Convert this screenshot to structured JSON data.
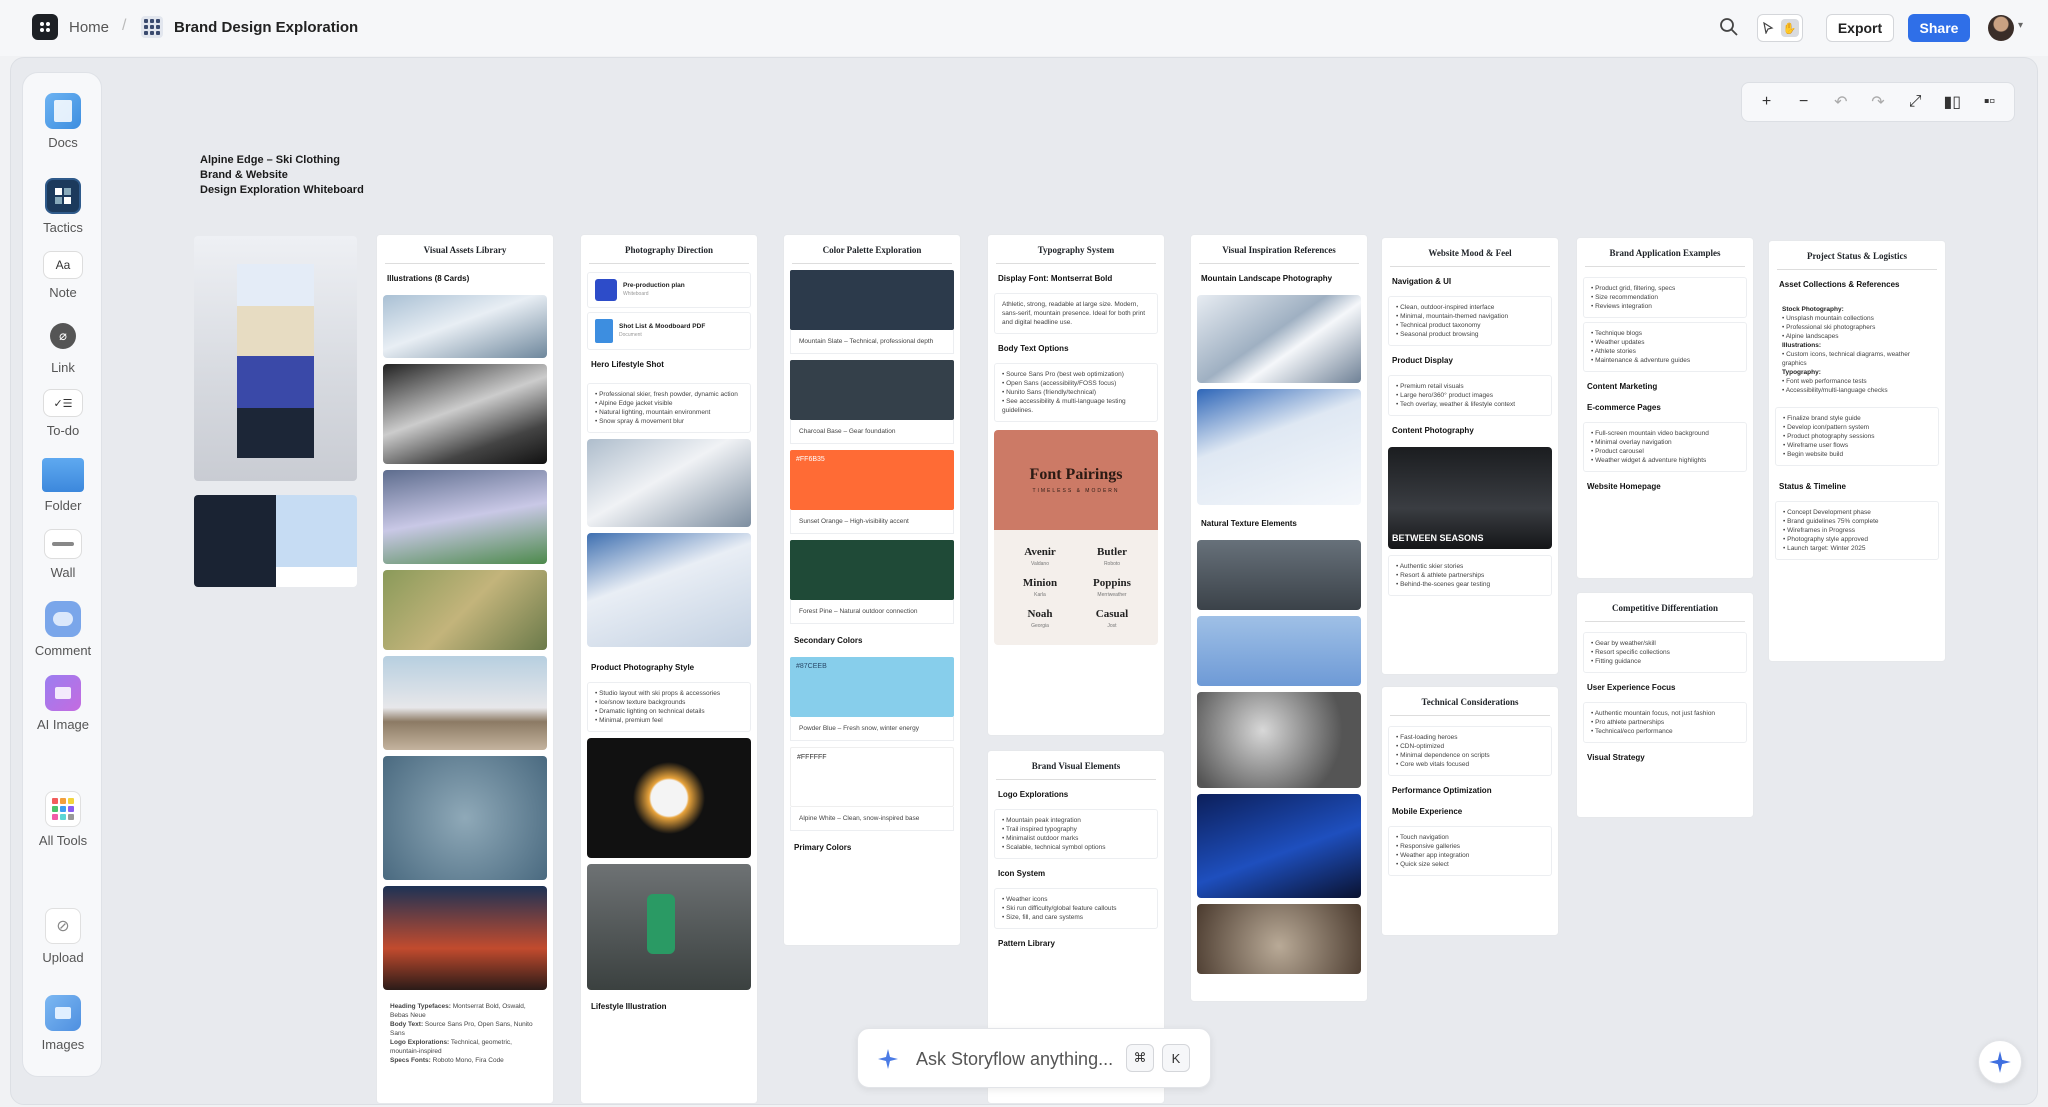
{
  "topbar": {
    "home": "Home",
    "title": "Brand Design Exploration",
    "export": "Export",
    "share": "Share"
  },
  "sidebar": {
    "items": [
      {
        "label": "Docs"
      },
      {
        "label": "Tactics"
      },
      {
        "label": "Note",
        "glyph": "Aa"
      },
      {
        "label": "Link"
      },
      {
        "label": "To-do"
      },
      {
        "label": "Folder"
      },
      {
        "label": "Wall"
      },
      {
        "label": "Comment"
      },
      {
        "label": "AI Image"
      },
      {
        "label": "All Tools"
      },
      {
        "label": "Upload"
      },
      {
        "label": "Images"
      }
    ]
  },
  "board": {
    "title_lines": [
      "Alpine Edge – Ski Clothing",
      "Brand & Website",
      "Design Exploration Whiteboard"
    ]
  },
  "visual_assets": {
    "header": "Visual Assets Library",
    "sub": "Illustrations (8 Cards)",
    "footer": [
      [
        "Heading Typefaces:",
        " Montserrat Bold, Oswald, Bebas Neue"
      ],
      [
        "Body Text:",
        " Source Sans Pro, Open Sans, Nunito Sans"
      ],
      [
        "Logo Explorations:",
        " Technical, geometric, mountain-inspired"
      ],
      [
        "Specs Fonts:",
        " Roboto Mono, Fira Code"
      ]
    ]
  },
  "photography": {
    "header": "Photography Direction",
    "doc1_title": "Pre-production plan",
    "doc1_sub": "Whiteboard",
    "doc2_title": "Shot List & Moodboard PDF",
    "doc2_sub": "Document",
    "hero": "Hero Lifestyle Shot",
    "hero_bullets": [
      "• Professional skier, fresh powder, dynamic action",
      "• Alpine Edge jacket visible",
      "• Natural lighting, mountain environment",
      "• Snow spray & movement blur"
    ],
    "product": "Product Photography Style",
    "product_bullets": [
      "• Studio layout with ski props & accessories",
      "• Ice/snow texture backgrounds",
      "• Dramatic lighting on technical details",
      "• Minimal, premium feel"
    ],
    "lifestyle": "Lifestyle Illustration"
  },
  "palette": {
    "header": "Color Palette Exploration",
    "swatches": [
      {
        "hex": "",
        "color": "#2c3a4b",
        "label": "Mountain Slate – Technical, professional depth"
      },
      {
        "hex": "",
        "color": "#34404a",
        "label": "Charcoal Base – Gear foundation"
      },
      {
        "hex": "#FF6B35",
        "color": "#ff6b35",
        "label": "Sunset Orange – High-visibility accent"
      },
      {
        "hex": "",
        "color": "#1f4a37",
        "label": "Forest Pine – Natural outdoor connection"
      }
    ],
    "secondary": "Secondary Colors",
    "secondary_swatches": [
      {
        "hex": "#87CEEB",
        "color": "#87ceeb",
        "label": "Powder Blue – Fresh snow, winter energy"
      },
      {
        "hex": "#FFFFFF",
        "color": "#ffffff",
        "label": "Alpine White – Clean, snow-inspired base"
      }
    ],
    "primary": "Primary Colors"
  },
  "typography": {
    "header": "Typography System",
    "display": "Display Font: Montserrat Bold",
    "display_text": "Athletic, strong, readable at large size. Modern, sans-serif, mountain presence. Ideal for both print and digital headline use.",
    "body": "Body Text Options",
    "body_bullets": [
      "• Source Sans Pro (best web optimization)",
      "• Open Sans (accessibility/FOSS focus)",
      "• Nunito Sans (friendly/technical)",
      "• See accessibility & multi-language testing guidelines."
    ],
    "fp_title": "Font Pairings",
    "fp_sub": "TIMELESS & MODERN",
    "fp_pairs": [
      {
        "a": "Avenir",
        "as": "Valdano",
        "b": "Butler",
        "bs": "Roboto"
      },
      {
        "a": "Minion",
        "as": "Karla",
        "b": "Poppins",
        "bs": "Merriweather"
      },
      {
        "a": "Noah",
        "as": "Georgia",
        "b": "Casual",
        "bs": "Jost"
      }
    ]
  },
  "brand_visual": {
    "header": "Brand Visual Elements",
    "logo": "Logo Explorations",
    "logo_bullets": [
      "• Mountain peak integration",
      "• Trail inspired typography",
      "• Minimalist outdoor marks",
      "• Scalable, technical symbol options"
    ],
    "icon": "Icon System",
    "icon_bullets": [
      "• Weather icons",
      "• Ski run difficulty/global feature callouts",
      "• Size, fill, and care systems"
    ],
    "pattern": "Pattern Library"
  },
  "inspiration": {
    "header": "Visual Inspiration References",
    "mountain": "Mountain Landscape Photography",
    "natural": "Natural Texture Elements"
  },
  "website": {
    "header": "Website Mood & Feel",
    "nav": "Navigation & UI",
    "nav_bullets": [
      "• Clean, outdoor-inspired interface",
      "• Minimal, mountain-themed navigation",
      "• Technical product taxonomy",
      "• Seasonal product browsing"
    ],
    "product": "Product Display",
    "product_bullets": [
      "• Premium retail visuals",
      "• Large hero/360° product images",
      "• Tech overlay, weather & lifestyle context"
    ],
    "content": "Content Photography",
    "between": "BETWEEN SEASONS",
    "content_bullets": [
      "• Authentic skier stories",
      "• Resort & athlete partnerships",
      "• Behind-the-scenes gear testing"
    ]
  },
  "technical": {
    "header": "Technical Considerations",
    "bullets1": [
      "• Fast-loading heroes",
      "• CDN-optimized",
      "• Minimal dependence on scripts",
      "• Core web vitals focused"
    ],
    "perf": "Performance Optimization",
    "mobile": "Mobile Experience",
    "bullets2": [
      "• Touch navigation",
      "• Responsive galleries",
      "• Weather app integration",
      "• Quick size select"
    ]
  },
  "brand_app": {
    "header": "Brand Application Examples",
    "b1": [
      "• Product grid, filtering, specs",
      "• Size recommendation",
      "• Reviews integration"
    ],
    "b2": [
      "• Technique blogs",
      "• Weather updates",
      "• Athlete stories",
      "• Maintenance & adventure guides"
    ],
    "content": "Content Marketing",
    "ecommerce": "E-commerce Pages",
    "b3": [
      "• Full-screen mountain video background",
      "• Minimal overlay navigation",
      "• Product carousel",
      "• Weather widget & adventure highlights"
    ],
    "homepage": "Website Homepage"
  },
  "competitive": {
    "header": "Competitive Differentiation",
    "b1": [
      "• Gear by weather/skill",
      "• Resort specific collections",
      "• Fitting guidance"
    ],
    "ux": "User Experience Focus",
    "b2": [
      "• Authentic mountain focus, not just fashion",
      "• Pro athlete partnerships",
      "• Technical/eco performance"
    ],
    "strategy": "Visual Strategy"
  },
  "status": {
    "header": "Project Status & Logistics",
    "assets": "Asset Collections & References",
    "stock": [
      [
        "Stock Photography:",
        true
      ],
      [
        "• Unsplash mountain collections",
        false
      ],
      [
        "• Professional ski photographers",
        false
      ],
      [
        "• Alpine landscapes",
        false
      ],
      [
        "Illustrations:",
        true
      ],
      [
        "• Custom icons, technical diagrams, weather graphics",
        false
      ],
      [
        "Typography:",
        true
      ],
      [
        "• Font web performance tests",
        false
      ],
      [
        "• Accessibility/multi-language checks",
        false
      ]
    ],
    "steps": [
      "• Finalize brand style guide",
      "• Develop icon/pattern system",
      "• Product photography sessions",
      "• Wireframe user flows",
      "• Begin website build"
    ],
    "timeline": "Status & Timeline",
    "timeline_bullets": [
      "• Concept Development phase",
      "• Brand guidelines 75% complete",
      "• Wireframes in Progress",
      "• Photography style approved",
      "• Launch target: Winter 2025"
    ]
  },
  "ask": {
    "placeholder": "Ask Storyflow anything...",
    "key1": "⌘",
    "key2": "K"
  }
}
